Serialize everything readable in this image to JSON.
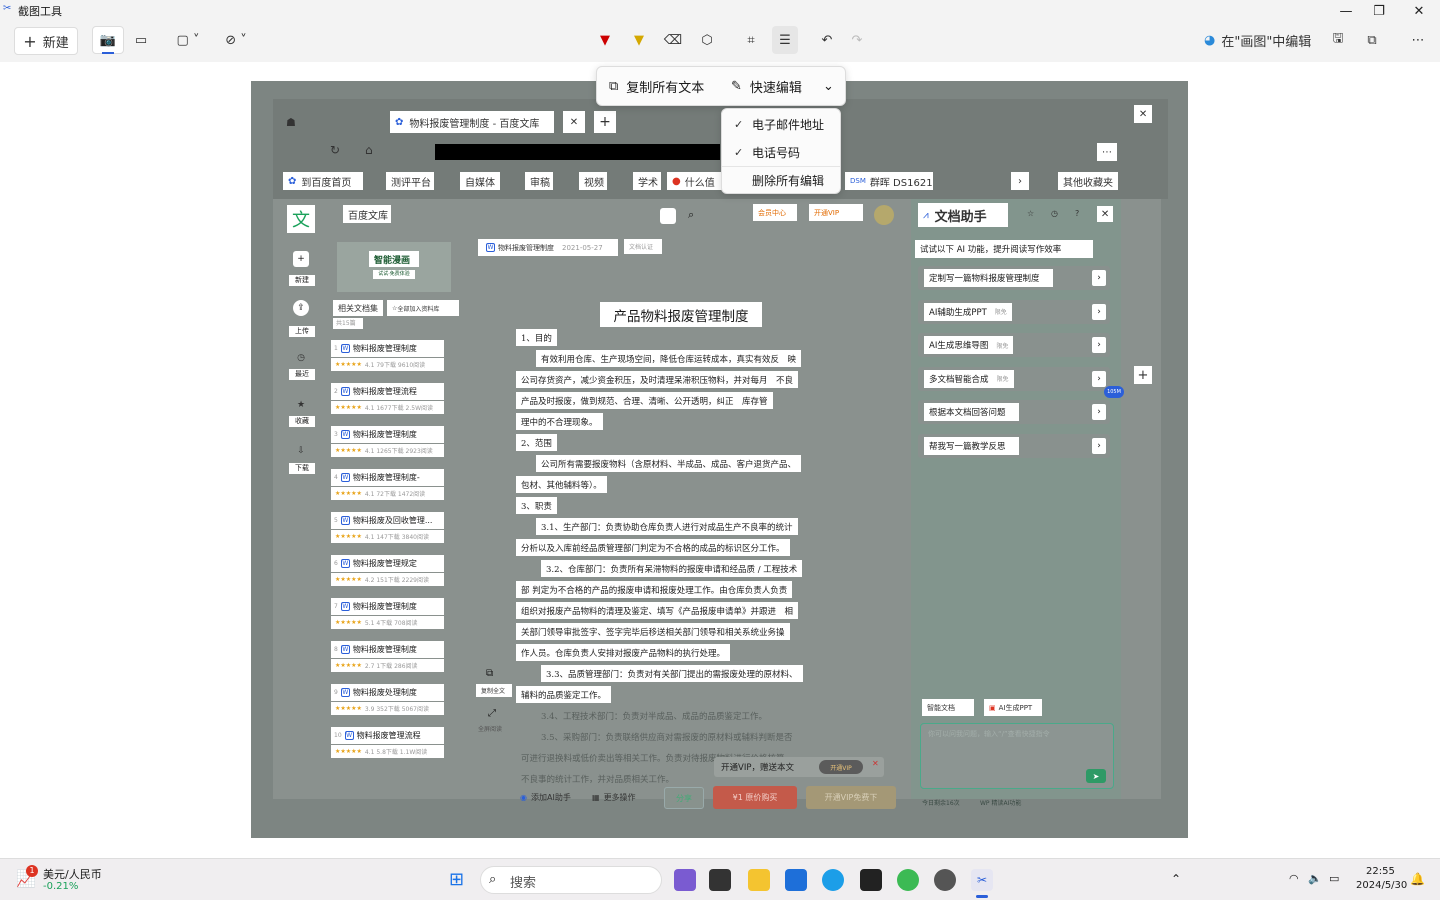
{
  "window": {
    "title": "截图工具"
  },
  "toolbar": {
    "new_label": "新建",
    "edit_in_paint": "在\"画图\"中编辑"
  },
  "popup": {
    "copy_all_text": "复制所有文本",
    "quick_edit": "快速编辑",
    "dropdown": [
      "电子邮件地址",
      "电话号码",
      "删除所有编辑"
    ]
  },
  "browser": {
    "tab_title": "物料报废管理制度 - 百度文库",
    "bookmarks": [
      "到百度首页",
      "测评平台",
      "自媒体",
      "审稿",
      "视频",
      "学术",
      "什么值",
      "群晖 DS1621+",
      "其他收藏夹"
    ],
    "site_name": "百度文库",
    "member_center": "会员中心",
    "open_vip": "开通VIP"
  },
  "sidebar": {
    "items": [
      "新建",
      "上传",
      "最近",
      "收藏",
      "下载"
    ]
  },
  "related": {
    "banner": "智能漫画",
    "banner_sub": "试试·免费体验",
    "header": "相关文档集",
    "add_all": "全部加入资料库",
    "count": "共15篇",
    "docs": [
      {
        "title": "物料报废管理制度",
        "meta": "4.1  79下载  9610阅读"
      },
      {
        "title": "物料报废管理流程",
        "meta": "4.1  1677下载  2.5W阅读"
      },
      {
        "title": "物料报废管理制度",
        "meta": "4.1  1265下载  2923阅读"
      },
      {
        "title": "物料报废管理制度-",
        "meta": "4.1  72下载  1472阅读"
      },
      {
        "title": "物料报废及回收管理...",
        "meta": "4.1  147下载  3840阅读"
      },
      {
        "title": "物料报废管理规定",
        "meta": "4.2  151下载  2229阅读"
      },
      {
        "title": "物料报废管理制度",
        "meta": "5.1  4下载  708阅读"
      },
      {
        "title": "物料报废管理制度",
        "meta": "2.7  1下载  286阅读"
      },
      {
        "title": "物料报废处理制度",
        "meta": "3.9  352下载  5067阅读"
      },
      {
        "title": "物料报废管理流程",
        "meta": "4.1  5.8下载  1.1W阅读"
      }
    ]
  },
  "doc": {
    "file_name": "物料报废管理制度",
    "date": "2021-05-27",
    "tag": "文档认证",
    "title": "产品物料报废管理制度",
    "lines": [
      "1、目的",
      "有效利用仓库、生产现场空间，降低仓库运转成本，真实有效反　映",
      "公司存货资产，减少资金积压，及时清理呆滞积压物料，并对每月　不良",
      "产品及时报废，做到规范、合理、清晰、公开透明，纠正　库存管",
      "理中的不合理现象。",
      "2、范围",
      "公司所有需要报废物料（含原材料、半成品、成品、客户退货产品、",
      "包材、其他辅料等）。",
      "3、职责",
      "3.1、生产部门：负责协助仓库负责人进行对成品生产不良率的统计",
      "分析以及入库前经品质管理部门判定为不合格的成品的标识区分工作。",
      "3.2、仓库部门：负责所有呆滞物料的报废申请和经品质 / 工程技术",
      "部 判定为不合格的产品的报废申请和报废处理工作。由仓库负责人负责",
      "组织对报废产品物料的清理及鉴定、填写《产品报废申请单》并跟进　相",
      "关部门领导审批签字、签字完毕后移送相关部门领导和相关系统业务操",
      "作人员。仓库负责人安排对报废产品物料的执行处理。",
      "3.3、品质管理部门：负责对有关部门提出的需报废处理的原材料、",
      "辅料的品质鉴定工作。",
      "3.4、工程技术部门：负责对半成品、成品的品质鉴定工作。",
      "3.5、采购部门：负责联络供应商对需报废的原材料或辅料判断是否",
      "可进行退换料或低价卖出等相关工作。负责对待报废物料进行价格核算。",
      "不良事的统计工作，并对品质相关工作。"
    ],
    "copy_full": "复制全文",
    "fullscreen": "全屏阅读",
    "vip_toast": "开通VIP，赠送本文",
    "vip_toast_btn": "开通VIP",
    "bottom_ai": "添加AI助手",
    "bottom_more": "更多操作",
    "share": "分享",
    "buy": "¥1 原价购买",
    "vip_free": "开通VIP免费下"
  },
  "assistant": {
    "title": "文档助手",
    "hint": "试试以下 AI 功能，提升阅读写作效率",
    "items": [
      {
        "label": "定制写一篇物料报废管理制度",
        "tag": ""
      },
      {
        "label": "AI辅助生成PPT",
        "tag": "限免"
      },
      {
        "label": "AI生成思维导图",
        "tag": "限免"
      },
      {
        "label": "多文档智能合成",
        "tag": "限免"
      },
      {
        "label": "根据本文档回答问题",
        "tag": ""
      },
      {
        "label": "帮我写一篇教学反思",
        "tag": ""
      }
    ],
    "chips": [
      "智能文档",
      "AI生成PPT"
    ],
    "input_placeholder": "你可以问我问题，输入“/”查看快捷指令",
    "footer": "今日剩余16次",
    "footer_right": "WP 精读AI功能"
  },
  "taskbar": {
    "widget_title": "美元/人民币",
    "widget_value": "-0.21%",
    "badge": "1",
    "search_placeholder": "搜索",
    "time": "22:55",
    "date": "2024/5/30"
  },
  "colors": {
    "accent": "#2b5fd9",
    "green": "#1aa15a",
    "positive": "#1aa15a"
  }
}
